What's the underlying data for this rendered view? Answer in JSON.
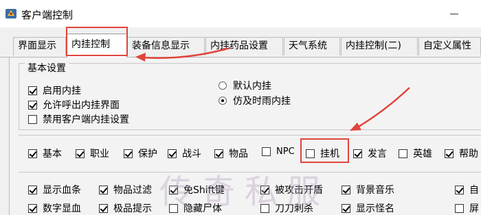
{
  "window": {
    "title": "客户端控制"
  },
  "tabs": [
    {
      "label": "界面显示",
      "active": false
    },
    {
      "label": "内挂控制",
      "active": true
    },
    {
      "label": "装备信息显示",
      "active": false
    },
    {
      "label": "内挂药品设置",
      "active": false
    },
    {
      "label": "天气系统",
      "active": false
    },
    {
      "label": "内挂控制(二)",
      "active": false
    },
    {
      "label": "自定义属性",
      "active": false
    }
  ],
  "basic_settings": {
    "legend": "基本设置",
    "checkboxes": [
      {
        "label": "启用内挂",
        "checked": true
      },
      {
        "label": "允许呼出内挂界面",
        "checked": true
      },
      {
        "label": "禁用客户端内挂设置",
        "checked": false
      }
    ],
    "radios": [
      {
        "label": "默认内挂",
        "selected": false
      },
      {
        "label": "仿及时雨内挂",
        "selected": true
      }
    ]
  },
  "channels": [
    {
      "label": "基本",
      "checked": true
    },
    {
      "label": "职业",
      "checked": true
    },
    {
      "label": "保护",
      "checked": true
    },
    {
      "label": "战斗",
      "checked": true
    },
    {
      "label": "物品",
      "checked": true
    },
    {
      "label": "NPC",
      "checked": false
    },
    {
      "label": "挂机",
      "checked": false
    },
    {
      "label": "发言",
      "checked": true
    },
    {
      "label": "英雄",
      "checked": false
    },
    {
      "label": "帮助",
      "checked": true
    }
  ],
  "options_row1": [
    {
      "label": "显示血条",
      "checked": true
    },
    {
      "label": "物品过滤",
      "checked": true
    },
    {
      "label": "免Shift键",
      "checked": true
    },
    {
      "label": "被攻击开盾",
      "checked": true
    },
    {
      "label": "背景音乐",
      "checked": true
    },
    {
      "label": "自",
      "checked": true
    }
  ],
  "options_row2": [
    {
      "label": "数字显血",
      "checked": true
    },
    {
      "label": "极品提示",
      "checked": true
    },
    {
      "label": "隐藏尸体",
      "checked": false
    },
    {
      "label": "刀刀刺杀",
      "checked": false
    },
    {
      "label": "显示怪名",
      "checked": true
    },
    {
      "label": "屏",
      "checked": false
    }
  ],
  "watermark": "传奇私服",
  "colors": {
    "highlight": "#e0443a",
    "tab_bg": "#f0f0f0",
    "pane_bg": "#f3f3f3"
  }
}
